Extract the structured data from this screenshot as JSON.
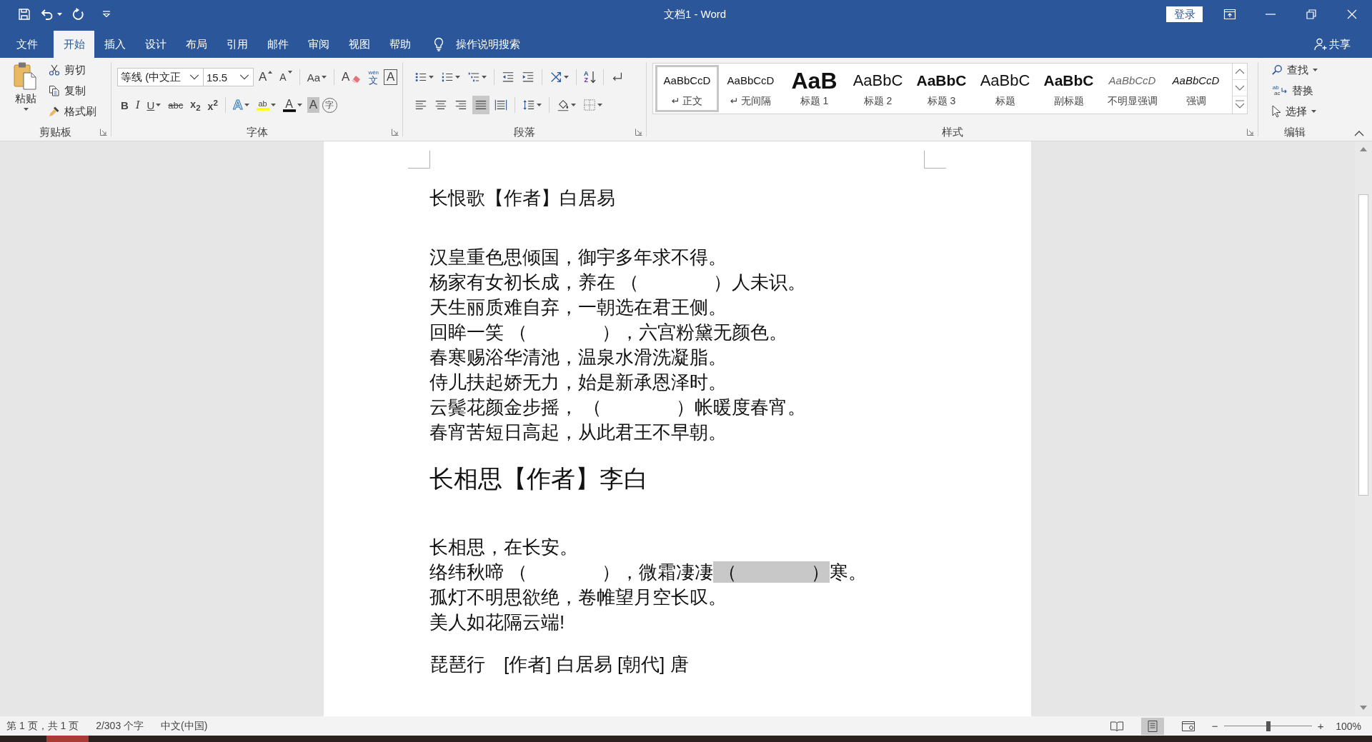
{
  "title_bar": {
    "title": "文档1 - Word",
    "sign_in": "登录"
  },
  "tabs": [
    {
      "label": "文件",
      "selected": false
    },
    {
      "label": "开始",
      "selected": true
    },
    {
      "label": "插入",
      "selected": false
    },
    {
      "label": "设计",
      "selected": false
    },
    {
      "label": "布局",
      "selected": false
    },
    {
      "label": "引用",
      "selected": false
    },
    {
      "label": "邮件",
      "selected": false
    },
    {
      "label": "审阅",
      "selected": false
    },
    {
      "label": "视图",
      "selected": false
    },
    {
      "label": "帮助",
      "selected": false
    }
  ],
  "tell_me": {
    "label": "操作说明搜索"
  },
  "share": {
    "label": "共享"
  },
  "clipboard": {
    "label": "剪贴板",
    "paste": "粘贴",
    "items": [
      {
        "kind": "cut",
        "label": "剪切"
      },
      {
        "kind": "copy",
        "label": "复制"
      },
      {
        "kind": "painter",
        "label": "格式刷"
      }
    ]
  },
  "font": {
    "label": "字体",
    "name": "等线 (中文正",
    "size": "15.5",
    "row_1": [
      {
        "kind": "grow",
        "glyph": "A"
      },
      {
        "kind": "shrink",
        "glyph": "A"
      },
      {
        "kind": "case",
        "glyph": "Aa"
      },
      {
        "kind": "clear",
        "glyph": "A"
      },
      {
        "kind": "phonetic",
        "glyph": "文",
        "ruby": "wén"
      },
      {
        "kind": "border",
        "glyph": "A"
      }
    ],
    "row_2": [
      {
        "kind": "bold",
        "glyph": "B"
      },
      {
        "kind": "italic",
        "glyph": "I"
      },
      {
        "kind": "underline",
        "glyph": "U"
      },
      {
        "kind": "strike",
        "glyph": "abc"
      },
      {
        "kind": "sub",
        "glyph": "x$_{2}$"
      },
      {
        "kind": "sup",
        "glyph": "x$^{2}$"
      },
      {
        "kind": "effects",
        "glyph": "A"
      },
      {
        "kind": "highlight",
        "glyph": "ab"
      },
      {
        "kind": "color",
        "glyph": "A"
      },
      {
        "kind": "shading",
        "glyph": "A"
      },
      {
        "kind": "enclose",
        "glyph": "字"
      }
    ]
  },
  "paragraph": {
    "label": "段落",
    "row_1": [
      {
        "kind": "bullets"
      },
      {
        "kind": "numbering"
      },
      {
        "kind": "multilevel"
      },
      {
        "kind": "outdent"
      },
      {
        "kind": "indent"
      },
      {
        "kind": "asian"
      },
      {
        "kind": "sort",
        "glyph": "A",
        "glyph_2": "Z"
      },
      {
        "kind": "marks"
      }
    ],
    "alignment": [
      {
        "kind": "left",
        "selected": false
      },
      {
        "kind": "center",
        "selected": false
      },
      {
        "kind": "right",
        "selected": false
      },
      {
        "kind": "justify",
        "selected": true
      },
      {
        "kind": "distribute",
        "selected": false
      }
    ],
    "row_2": [
      {
        "kind": "spacing"
      },
      {
        "kind": "shading"
      },
      {
        "kind": "borders"
      }
    ]
  },
  "styles": {
    "label": "样式",
    "items": [
      {
        "kind": "normal",
        "preview": "AaBbCcD",
        "name": "↵ 正文",
        "selected": true
      },
      {
        "kind": "normal",
        "preview": "AaBbCcD",
        "name": "↵ 无间隔",
        "selected": false
      },
      {
        "kind": "heading_1",
        "preview": "AaB",
        "name": "标题 1",
        "selected": false
      },
      {
        "kind": "heading_2",
        "preview": "AaBbC",
        "name": "标题 2",
        "selected": false
      },
      {
        "kind": "heading_3",
        "preview": "AaBbC",
        "name": "标题 3",
        "selected": false
      },
      {
        "kind": "title",
        "preview": "AaBbC",
        "name": "标题",
        "selected": false
      },
      {
        "kind": "subtitle",
        "preview": "AaBbC",
        "name": "副标题",
        "selected": false
      },
      {
        "kind": "subtle",
        "preview": "AaBbCcD",
        "name": "不明显强调",
        "selected": false
      },
      {
        "kind": "emphasis",
        "preview": "AaBbCcD",
        "name": "强调",
        "selected": false
      }
    ]
  },
  "editing": {
    "label": "编辑",
    "items": [
      {
        "kind": "find",
        "label": "查找"
      },
      {
        "kind": "replace",
        "label": "替换",
        "glyph": "ab",
        "glyph_2": "ac"
      },
      {
        "kind": "select",
        "label": "选择"
      }
    ]
  },
  "document": {
    "blocks": [
      {
        "kind": "title",
        "text": "长恨歌【作者】白居易"
      },
      {
        "kind": "verse",
        "text": "汉皇重色思倾国，御宇多年求不得。"
      },
      {
        "kind": "verse",
        "text": "杨家有女初长成，养在 （　　　　）人未识。"
      },
      {
        "kind": "verse",
        "text": "天生丽质难自弃，一朝选在君王侧。"
      },
      {
        "kind": "verse",
        "text": "回眸一笑 （　　　　），六宫粉黛无颜色。"
      },
      {
        "kind": "verse",
        "text": "春寒赐浴华清池，温泉水滑洗凝脂。"
      },
      {
        "kind": "verse",
        "text": "侍儿扶起娇无力，始是新承恩泽时。"
      },
      {
        "kind": "verse",
        "text": "云鬓花颜金步摇， （　　　　）帐暖度春宵。"
      },
      {
        "kind": "verse",
        "text": "春宵苦短日高起，从此君王不早朝。"
      },
      {
        "kind": "heading",
        "text": "长相思【作者】李白"
      },
      {
        "kind": "verse",
        "text": "长相思，在长安。"
      },
      {
        "kind": "verse",
        "segments": [
          {
            "text": "络纬秋啼 （　　　　），微霜凄凄",
            "selected": false
          },
          {
            "text": " （　　　　）",
            "selected": true
          },
          {
            "text": "寒。",
            "selected": false
          }
        ]
      },
      {
        "kind": "verse",
        "text": "孤灯不明思欲绝，卷帷望月空长叹。"
      },
      {
        "kind": "verse",
        "text": "美人如花隔云端!"
      },
      {
        "kind": "title",
        "text": "琵琶行　[作者] 白居易 [朝代] 唐"
      }
    ]
  },
  "status_bar": {
    "page": "第 1 页，共 1 页",
    "words": "2/303 个字",
    "language": "中文(中国)",
    "views": [
      {
        "kind": "read",
        "selected": false
      },
      {
        "kind": "print",
        "selected": true
      },
      {
        "kind": "web",
        "selected": false
      }
    ],
    "zoom_out": "−",
    "zoom": {
      "level": 0.5
    },
    "zoom_in": "+",
    "zoom_label": "100%"
  }
}
